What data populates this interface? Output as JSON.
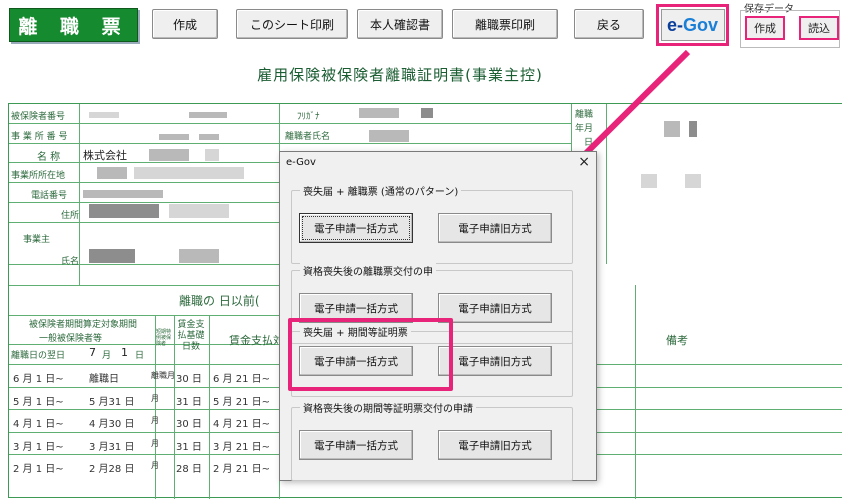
{
  "toolbar": {
    "title": "離 職 票",
    "create": "作成",
    "print_sheet": "このシート印刷",
    "id_check": "本人確認書",
    "print_rikyo": "離職票印刷",
    "back": "戻る",
    "egov_logo_e": "e-",
    "egov_logo_gov": "Gov",
    "save_label": "保存データ",
    "save_create": "作成",
    "save_load": "読込"
  },
  "doc_title": "雇用保険被保険者離職証明書(事業主控)",
  "form": {
    "insured_no": "被保険者番号",
    "office_no": "事 業 所 番 号",
    "name_label": "名 称",
    "company": "株式会社",
    "office_addr": "事業所所在地",
    "tel": "電話番号",
    "address": "住所",
    "employer": "事業主",
    "emp_name": "氏名",
    "furigana": "ﾌﾘｶﾞﾅ",
    "leaver_name": "離職者氏名",
    "leave_date": "離職",
    "leave_ym": "年月",
    "leave_d": "日",
    "wage_header": "離職の 日以前(",
    "period_head": "被保険者期間算定対象期間",
    "general": "一般被保険者等",
    "short_term": "短期特例被保険者",
    "next_day": "離職日の翌日",
    "next_month": "7",
    "next_m_unit": "月",
    "next_dnum": "1",
    "next_d_unit": "日",
    "base_days_head": "賃金支払基礎日数",
    "wage_period": "賃金支払対",
    "remarks": "備考",
    "rows": [
      {
        "from": "6 月 1 日~",
        "to": "離職日",
        "m": "離職月",
        "days": "30 日",
        "pay": "6 月 21 日~"
      },
      {
        "from": "5 月 1 日~",
        "to": "5 月31 日",
        "m": "月",
        "days": "31 日",
        "pay": "5 月 21 日~"
      },
      {
        "from": "4 月 1 日~",
        "to": "4 月30 日",
        "m": "月",
        "days": "30 日",
        "pay": "4 月 21 日~"
      },
      {
        "from": "3 月 1 日~",
        "to": "3 月31 日",
        "m": "月",
        "days": "31 日",
        "pay": "3 月 21 日~"
      },
      {
        "from": "2 月 1 日~",
        "to": "2 月28 日",
        "m": "月",
        "days": "28 日",
        "pay": "2 月 21 日~"
      }
    ]
  },
  "dialog": {
    "title": "e-Gov",
    "close": "×",
    "groups": [
      {
        "label": "喪失届 + 離職票 (通常のパターン)",
        "btn1": "電子申請一括方式",
        "btn2": "電子申請旧方式"
      },
      {
        "label": "資格喪失後の離職票交付の申",
        "btn1": "電子申請一括方式",
        "btn2": "電子申請旧方式"
      },
      {
        "label": "喪失届 + 期間等証明票",
        "btn1": "電子申請一括方式",
        "btn2": "電子申請旧方式"
      },
      {
        "label": "資格喪失後の期間等証明票交付の申請",
        "btn1": "電子申請一括方式",
        "btn2": "電子申請旧方式"
      }
    ]
  },
  "colors": {
    "accent": "#e8237a",
    "title_green": "#168a2e"
  }
}
